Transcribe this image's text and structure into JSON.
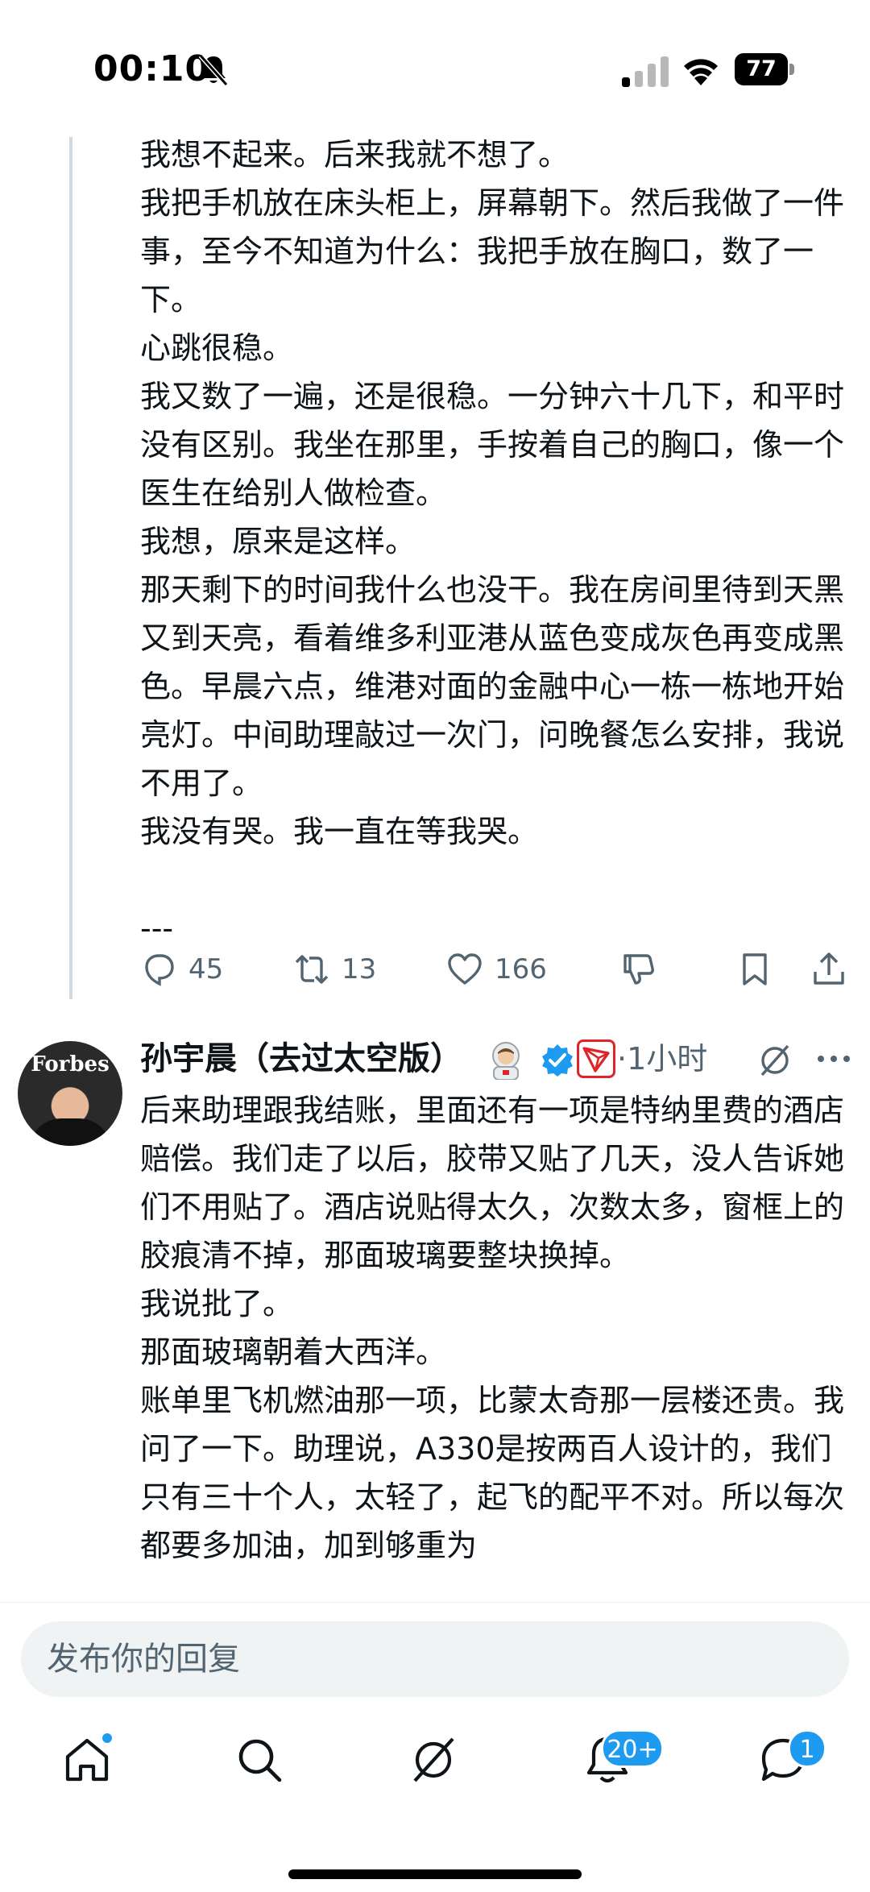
{
  "status_bar": {
    "time": "00:10",
    "battery": "77"
  },
  "thread_post": {
    "paragraphs": [
      "我想不起来。后来我就不想了。",
      "我把手机放在床头柜上，屏幕朝下。然后我做了一件事，至今不知道为什么：我把手放在胸口，数了一下。",
      "心跳很稳。",
      "我又数了一遍，还是很稳。一分钟六十几下，和平时没有区别。我坐在那里，手按着自己的胸口，像一个医生在给别人做检查。",
      "我想，原来是这样。",
      "那天剩下的时间我什么也没干。我在房间里待到天黑又到天亮，看着维多利亚港从蓝色变成灰色再变成黑色。早晨六点，维港对面的金融中心一栋一栋地开始亮灯。中间助理敲过一次门，问晚餐怎么安排，我说不用了。",
      "我没有哭。我一直在等我哭。",
      "",
      "---"
    ],
    "actions": {
      "replies": "45",
      "reposts": "13",
      "likes": "166"
    }
  },
  "next_post": {
    "author": "孙宇晨（去过太空版）",
    "time": "·1小时",
    "avatar_text": "Forbes",
    "paragraphs": [
      "后来助理跟我结账，里面还有一项是特纳里费的酒店赔偿。我们走了以后，胶带又贴了几天，没人告诉她们不用贴了。酒店说贴得太久，次数太多，窗框上的胶痕清不掉，那面玻璃要整块换掉。",
      "我说批了。",
      "那面玻璃朝着大西洋。",
      "账单里飞机燃油那一项，比蒙太奇那一层楼还贵。我问了一下。助理说，A330是按两百人设计的，我们只有三十个人，太轻了，起飞的配平不对。所以每次都要多加油，加到够重为"
    ]
  },
  "compose": {
    "placeholder": "发布你的回复"
  },
  "nav": {
    "notifications_badge": "20+",
    "messages_badge": "1"
  },
  "colors": {
    "accent": "#1d9bf0",
    "text": "#0f1419",
    "muted": "#536471"
  }
}
